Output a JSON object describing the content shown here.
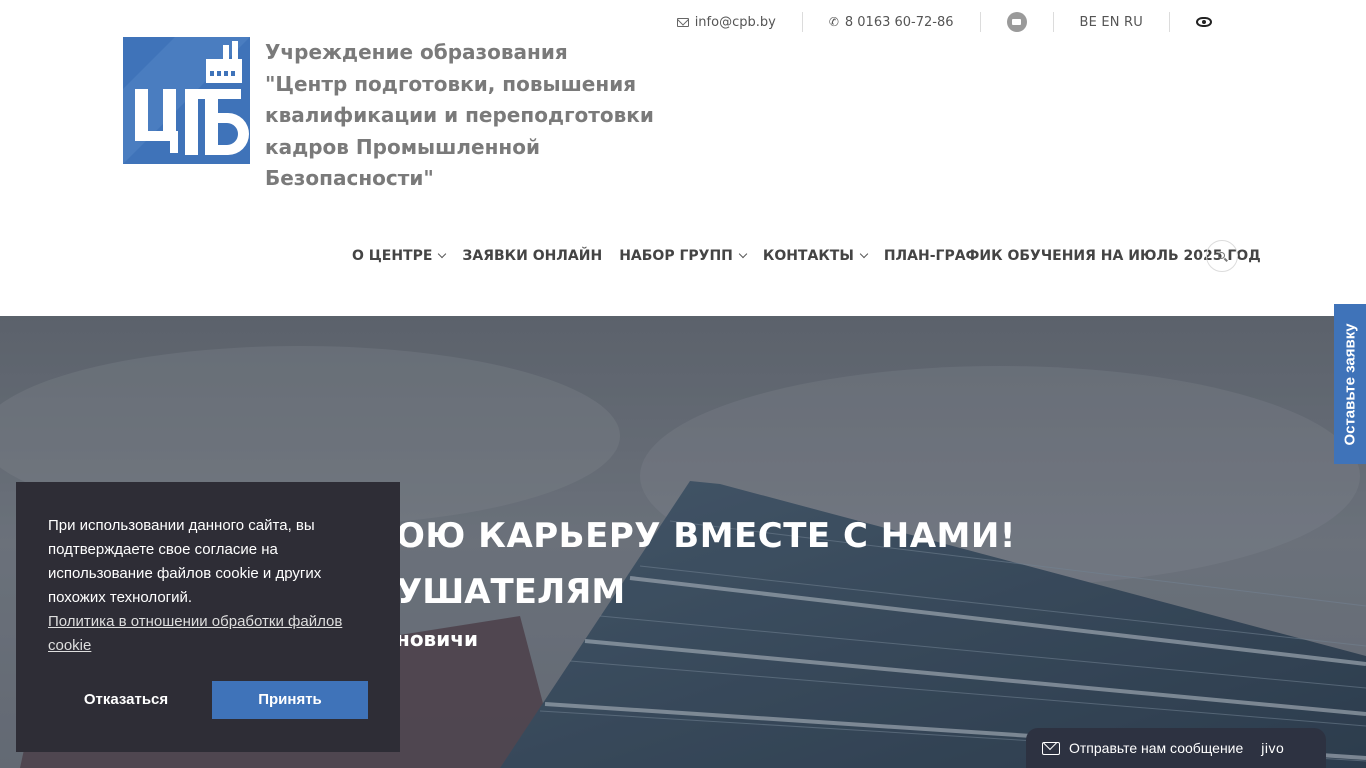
{
  "topbar": {
    "email": "info@cpb.by",
    "phone": "8 0163 60-72-86",
    "languages": "BE EN RU"
  },
  "logo": {
    "lettering": "ЦПБ",
    "color": "#3f73b9"
  },
  "org": {
    "line1": "Учреждение образования",
    "line2": "\"Центр подготовки, повышения",
    "line3": "квалификации и переподготовки",
    "line4": "кадров Промышленной Безопасности\""
  },
  "nav": {
    "items": [
      {
        "label": "О ЦЕНТРЕ",
        "dropdown": true
      },
      {
        "label": "ЗАЯВКИ ОНЛАЙН",
        "dropdown": false
      },
      {
        "label": "НАБОР ГРУПП",
        "dropdown": true
      },
      {
        "label": "КОНТАКТЫ",
        "dropdown": true
      },
      {
        "label": "ПЛАН-ГРАФИК ОБУЧЕНИЯ НА ИЮЛЬ 2025 ГОД",
        "dropdown": false
      }
    ]
  },
  "hero": {
    "heading1": "ОЮ КАРЬЕРУ ВМЕСТЕ С НАМИ!",
    "heading2": "УШАТЕЛЯМ",
    "subtitle": "новичи"
  },
  "side_tab": {
    "label": "Оставьте заявку"
  },
  "cookie": {
    "text": "При использовании данного сайта, вы подтверждаете свое согласие на использование файлов cookie и других похожих технологий.",
    "policy_link": "Политика в отношении обработки файлов cookie",
    "decline": "Отказаться",
    "accept": "Принять"
  },
  "chat": {
    "label": "Отправьте нам сообщение",
    "brand": "jivo"
  },
  "colors": {
    "brand_blue": "#3f73b9",
    "cookie_bg": "#2e2d36",
    "chat_bg": "#2d3241",
    "title_gray": "#7a7a7a"
  }
}
